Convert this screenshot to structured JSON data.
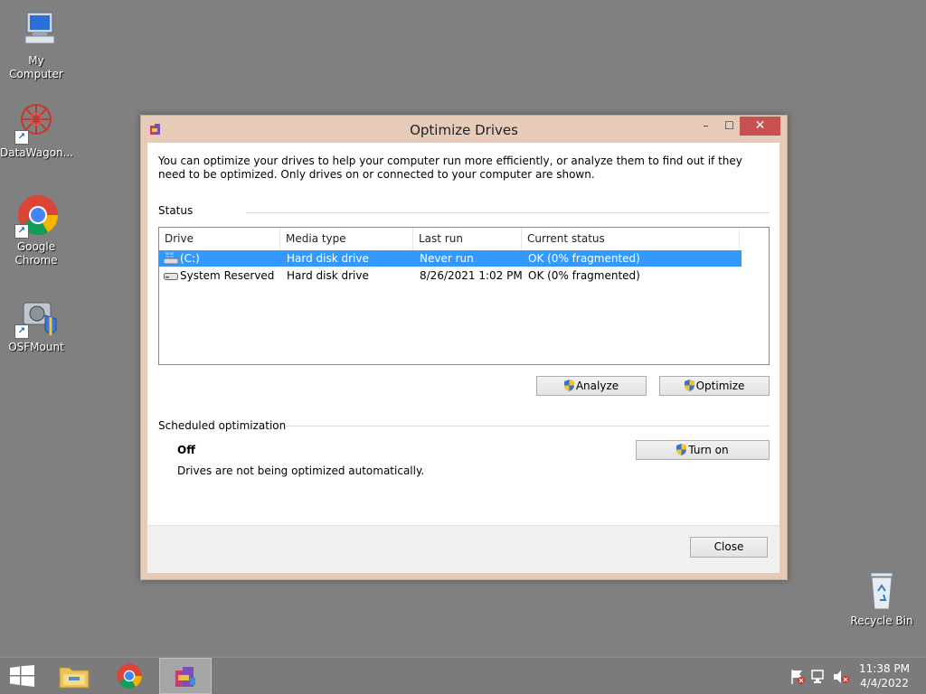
{
  "desktop": {
    "icons": [
      {
        "label": "My Computer",
        "icon": "computer-icon"
      },
      {
        "label": "DataWagon...",
        "icon": "datawagon-icon"
      },
      {
        "label": "Google Chrome",
        "icon": "chrome-icon"
      },
      {
        "label": "OSFMount",
        "icon": "osfmount-icon"
      },
      {
        "label": "Recycle Bin",
        "icon": "recycle-bin-icon"
      }
    ]
  },
  "window": {
    "title": "Optimize Drives",
    "controls": {
      "minimize": "–",
      "maximize": "☐",
      "close": "✕"
    },
    "description": "You can optimize your drives to help your computer run more efficiently, or analyze them to find out if they need to be optimized. Only drives on or connected to your computer are shown.",
    "status_label": "Status",
    "columns": [
      "Drive",
      "Media type",
      "Last run",
      "Current status"
    ],
    "drives": [
      {
        "drive": "(C:)",
        "media_type": "Hard disk drive",
        "last_run": "Never run",
        "current_status": "OK (0% fragmented)",
        "selected": true
      },
      {
        "drive": "System Reserved",
        "media_type": "Hard disk drive",
        "last_run": "8/26/2021 1:02 PM",
        "current_status": "OK (0% fragmented)",
        "selected": false
      }
    ],
    "analyze_label": "Analyze",
    "optimize_label": "Optimize",
    "scheduled_label": "Scheduled optimization",
    "schedule_state": "Off",
    "schedule_desc": "Drives are not being optimized automatically.",
    "turn_on_label": "Turn on",
    "close_label": "Close"
  },
  "taskbar": {
    "time": "11:38 PM",
    "date": "4/4/2022"
  },
  "colors": {
    "desktop": "#808080",
    "window_frame": "#e6ccb8",
    "close_button": "#c75050",
    "selection": "#3399ff"
  }
}
